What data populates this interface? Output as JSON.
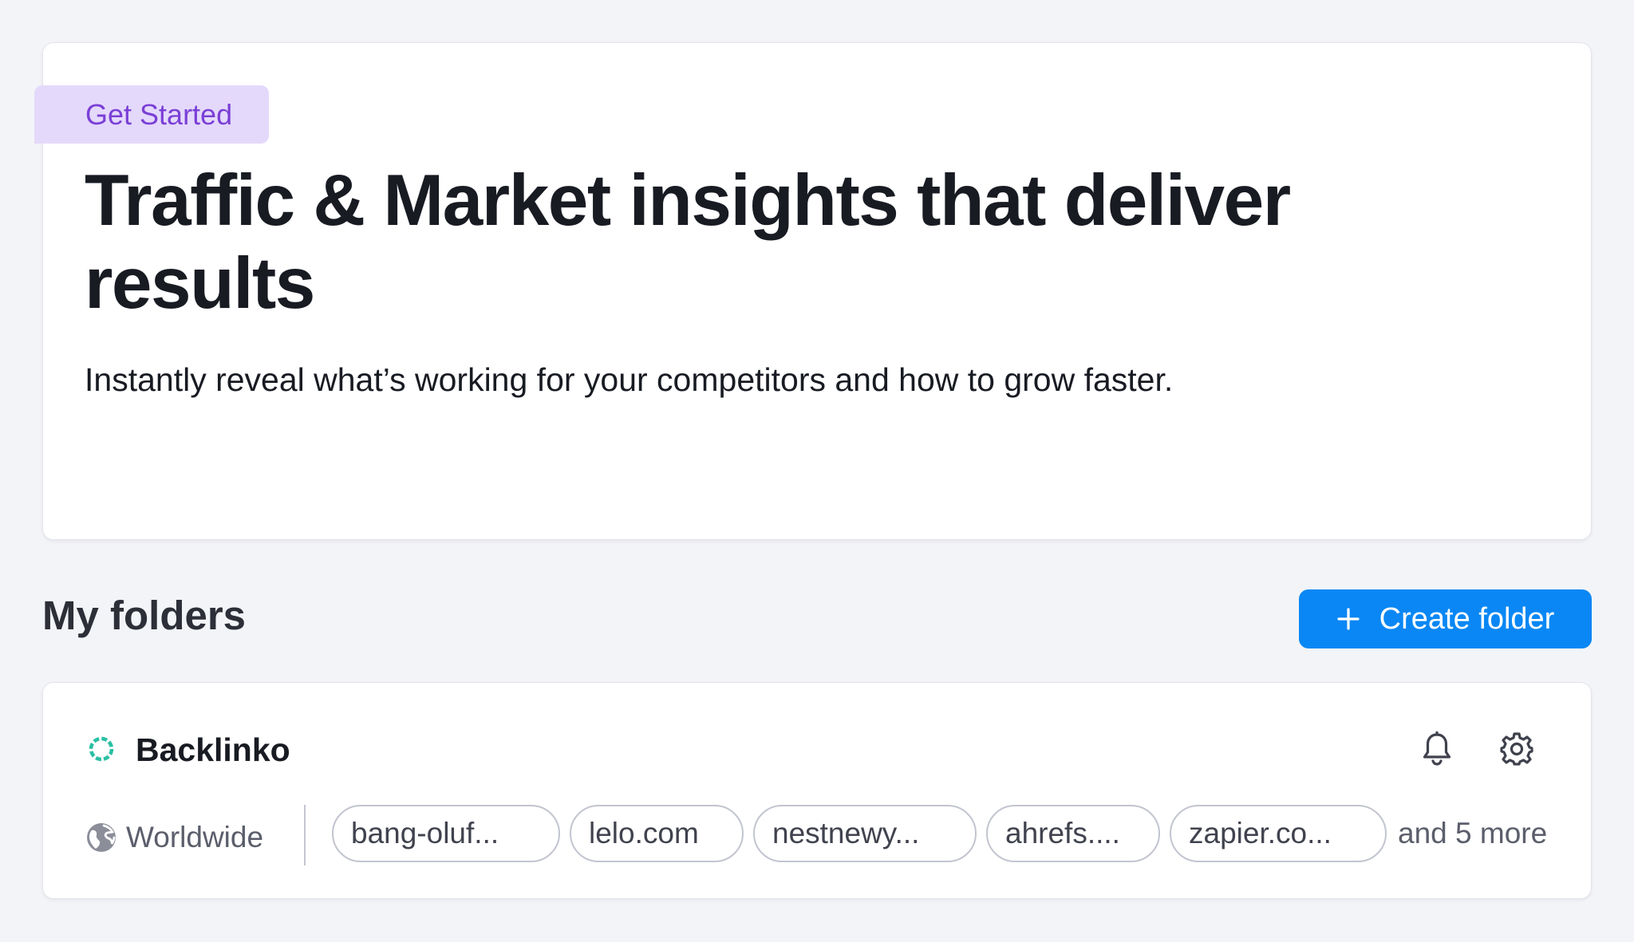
{
  "hero": {
    "badge": "Get Started",
    "title": "Traffic & Market insights that deliver results",
    "subtitle": "Instantly reveal what’s working for your competitors and how to grow faster."
  },
  "folders": {
    "heading": "My folders",
    "create_label": "Create folder",
    "items": [
      {
        "name": "Backlinko",
        "region": "Worldwide",
        "domains": [
          "bang-oluf...",
          "lelo.com",
          "nestnewy...",
          "ahrefs....",
          "zapier.co..."
        ],
        "more": "and 5 more"
      }
    ]
  },
  "colors": {
    "accent": "#0a87f4",
    "badge_bg": "#e4d9fb",
    "badge_text": "#7a3fd6",
    "status_ring": "#2bbfa4",
    "page_bg": "#f3f4f8"
  },
  "icons": {
    "create": "plus-icon",
    "status": "folder-status-ring-icon",
    "alerts": "bell-icon",
    "settings": "gear-icon",
    "region": "globe-icon"
  }
}
